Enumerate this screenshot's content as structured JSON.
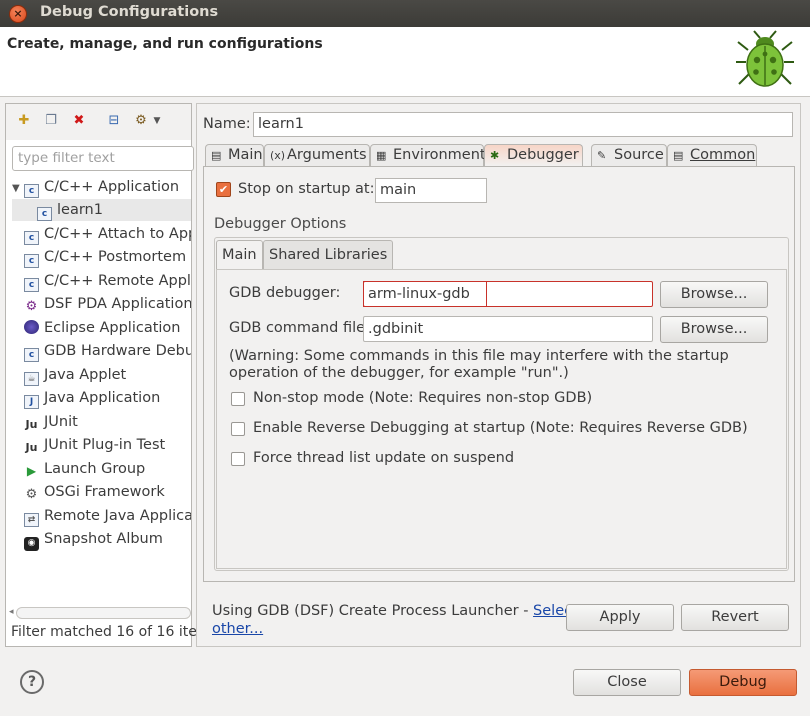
{
  "window": {
    "title": "Debug Configurations",
    "close_glyph": "×"
  },
  "banner": {
    "text": "Create, manage, and run configurations",
    "icon": "bug-icon"
  },
  "left": {
    "toolbar_icons": [
      "new-config-icon",
      "duplicate-icon",
      "delete-icon",
      "collapse-all-icon",
      "filter-icon"
    ],
    "filter_placeholder": "type filter text",
    "tree": [
      {
        "label": "C/C++ Application",
        "icon": "c-app-icon",
        "expanded": true
      },
      {
        "label": "learn1",
        "icon": "c-app-icon",
        "child": true,
        "selected": true
      },
      {
        "label": "C/C++ Attach to Applic",
        "icon": "c-app-icon"
      },
      {
        "label": "C/C++ Postmortem De",
        "icon": "c-app-icon"
      },
      {
        "label": "C/C++ Remote Applic",
        "icon": "c-app-icon"
      },
      {
        "label": "DSF PDA Application",
        "icon": "gear-icon"
      },
      {
        "label": "Eclipse Application",
        "icon": "eclipse-icon"
      },
      {
        "label": "GDB Hardware Debug",
        "icon": "c-app-icon"
      },
      {
        "label": "Java Applet",
        "icon": "applet-icon"
      },
      {
        "label": "Java Application",
        "icon": "java-icon"
      },
      {
        "label": "JUnit",
        "icon": "junit-icon"
      },
      {
        "label": "JUnit Plug-in Test",
        "icon": "junit-plugin-icon"
      },
      {
        "label": "Launch Group",
        "icon": "launch-group-icon"
      },
      {
        "label": "OSGi Framework",
        "icon": "osgi-icon"
      },
      {
        "label": "Remote Java Applicat",
        "icon": "remote-java-icon"
      },
      {
        "label": "Snapshot Album",
        "icon": "camera-icon"
      }
    ],
    "status": "Filter matched 16 of 16 ite"
  },
  "config": {
    "name_label": "Name:",
    "name_value": "learn1",
    "tabs": [
      {
        "label": "Main",
        "icon": "main-tab-icon"
      },
      {
        "label": "Arguments",
        "icon": "arguments-tab-icon"
      },
      {
        "label": "Environment",
        "icon": "environment-tab-icon"
      },
      {
        "label": "Debugger",
        "icon": "debugger-tab-icon",
        "active": true
      },
      {
        "label": "Source",
        "icon": "source-tab-icon"
      },
      {
        "label": "Common",
        "icon": "common-tab-icon"
      }
    ],
    "stop_on_startup_label": "Stop on startup at:",
    "stop_on_startup_value": "main",
    "stop_on_startup_checked": true,
    "debugger_options_label": "Debugger Options",
    "inner_tabs": [
      "Main",
      "Shared Libraries"
    ],
    "gdb_debugger_label": "GDB debugger:",
    "gdb_debugger_value": "arm-linux-gdb",
    "gdb_command_file_label": "GDB command file:",
    "gdb_command_file_value": ".gdbinit",
    "browse_label": "Browse...",
    "warning": "(Warning: Some commands in this file may interfere with the startup operation of the debugger, for example \"run\".)",
    "checkboxes": [
      {
        "label": "Non-stop mode (Note: Requires non-stop GDB)",
        "checked": false
      },
      {
        "label": "Enable Reverse Debugging at startup (Note: Requires Reverse GDB)",
        "checked": false
      },
      {
        "label": "Force thread list update on suspend",
        "checked": false
      }
    ],
    "launcher_text": "Using GDB (DSF) Create Process Launcher - ",
    "launcher_link_1": "Select",
    "launcher_link_2": "other...",
    "apply_label": "Apply",
    "revert_label": "Revert"
  },
  "footer": {
    "help_glyph": "?",
    "close_label": "Close",
    "debug_label": "Debug"
  },
  "colors": {
    "accent": "#e9703f",
    "highlight_box": "#c8322a",
    "link": "#1a47a8"
  }
}
